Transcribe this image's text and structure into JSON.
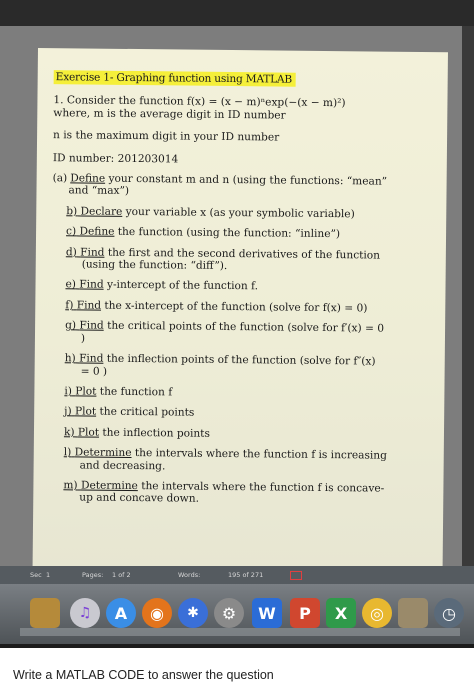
{
  "document": {
    "title": "Exercise 1- Graphing function using MATLAB",
    "question_line1": "1. Consider the function f(x) = (x − m)ⁿexp(−(x − m)²)",
    "question_line2": "where, m is the average digit in ID number",
    "n_line": "n is the maximum digit in your ID number",
    "id_line": "ID number: 201203014",
    "items": [
      {
        "label": "(a)",
        "verb": "Define",
        "text": "your constant m and n (using the functions: “mean”",
        "cont": "and “max”)"
      },
      {
        "label": "b)",
        "verb": "Declare",
        "text": "your variable x (as your symbolic variable)"
      },
      {
        "label": "c)",
        "verb": "Define",
        "text": "the function (using the function: “inline”)"
      },
      {
        "label": "d)",
        "verb": "Find",
        "text": "the first and the second derivatives of the function",
        "cont": "(using the function: “diff”)."
      },
      {
        "label": "e)",
        "verb": "Find",
        "text": "y-intercept of the function f."
      },
      {
        "label": "f)",
        "verb": "Find",
        "text": "the x-intercept of the function (solve for f(x) = 0)"
      },
      {
        "label": "g)",
        "verb": "Find",
        "text": "the critical points of the function (solve for f′(x) = 0",
        "cont": ")"
      },
      {
        "label": "h)",
        "verb": "Find",
        "text": "the inflection points of the function (solve for f″(x)",
        "cont": "= 0 )"
      },
      {
        "label": "i)",
        "verb": "Plot",
        "text": "the function f"
      },
      {
        "label": "j)",
        "verb": "Plot",
        "text": "the critical points"
      },
      {
        "label": "k)",
        "verb": "Plot",
        "text": "the inflection points"
      },
      {
        "label": "l)",
        "verb": "Determine",
        "text": "the intervals where the function f is increasing",
        "cont": "and decreasing."
      },
      {
        "label": "m)",
        "verb": "Determine",
        "text": "the intervals where the function f is concave-",
        "cont": "up and concave down."
      }
    ]
  },
  "status_bar": {
    "sec": "Sec",
    "sec_value": "1",
    "pages_label": "Pages:",
    "pages_value": "1 of 2",
    "words_label": "Words:",
    "words_value": "195 of 271"
  },
  "dock": {
    "icons": [
      {
        "name": "app-store-icon",
        "color": "#b58a3a"
      },
      {
        "name": "itunes-icon",
        "color": "#c9c9d0"
      },
      {
        "name": "app-store-a-icon",
        "color": "#3a8ee6"
      },
      {
        "name": "firefox-icon",
        "color": "#e3741c"
      },
      {
        "name": "safari-icon",
        "color": "#3a6fd8"
      },
      {
        "name": "system-preferences-icon",
        "color": "#8a8a8a"
      },
      {
        "name": "word-icon",
        "color": "#2b6cd6"
      },
      {
        "name": "powerpoint-icon",
        "color": "#d0472f"
      },
      {
        "name": "excel-icon",
        "color": "#2f9a4a"
      },
      {
        "name": "chrome-icon",
        "color": "#e8b830"
      },
      {
        "name": "photo-icon",
        "color": "#9a8a6a"
      },
      {
        "name": "time-machine-icon",
        "color": "#5a6a7a"
      }
    ]
  },
  "caption": "Write  a MATLAB CODE to answer the question",
  "colors": {
    "highlight": "#f5ef3a",
    "page": "#f0efd8"
  }
}
